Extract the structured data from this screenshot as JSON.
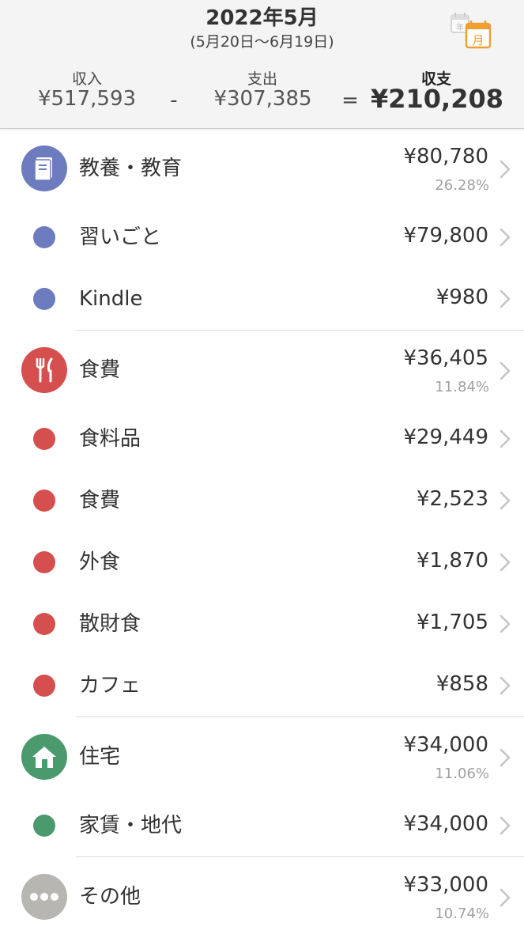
{
  "header": {
    "month_title": "2022年5月",
    "date_range": "(5月20日〜6月19日)",
    "calendar_year_glyph": "年",
    "calendar_month_glyph": "月",
    "accent_color": "#f0a030"
  },
  "summary": {
    "income_label": "収入",
    "income_value": "¥517,593",
    "minus": "-",
    "expense_label": "支出",
    "expense_value": "¥307,385",
    "equal": "=",
    "balance_label": "収支",
    "balance_value": "¥210,208"
  },
  "groups": [
    {
      "name": "教養・教育",
      "amount": "¥80,780",
      "percent": "26.28%",
      "color": "#6d7bbf",
      "icon": "book-icon",
      "items": [
        {
          "name": "習いごと",
          "amount": "¥79,800"
        },
        {
          "name": "Kindle",
          "amount": "¥980"
        }
      ]
    },
    {
      "name": "食費",
      "amount": "¥36,405",
      "percent": "11.84%",
      "color": "#d54f4f",
      "icon": "fork-knife-icon",
      "items": [
        {
          "name": "食料品",
          "amount": "¥29,449"
        },
        {
          "name": "食費",
          "amount": "¥2,523"
        },
        {
          "name": "外食",
          "amount": "¥1,870"
        },
        {
          "name": "散財食",
          "amount": "¥1,705"
        },
        {
          "name": "カフェ",
          "amount": "¥858"
        }
      ]
    },
    {
      "name": "住宅",
      "amount": "¥34,000",
      "percent": "11.06%",
      "color": "#4a9a6e",
      "icon": "house-icon",
      "items": [
        {
          "name": "家賃・地代",
          "amount": "¥34,000"
        }
      ]
    },
    {
      "name": "その他",
      "amount": "¥33,000",
      "percent": "10.74%",
      "color": "#b8b6b2",
      "icon": "more-dots-icon",
      "items": []
    }
  ]
}
